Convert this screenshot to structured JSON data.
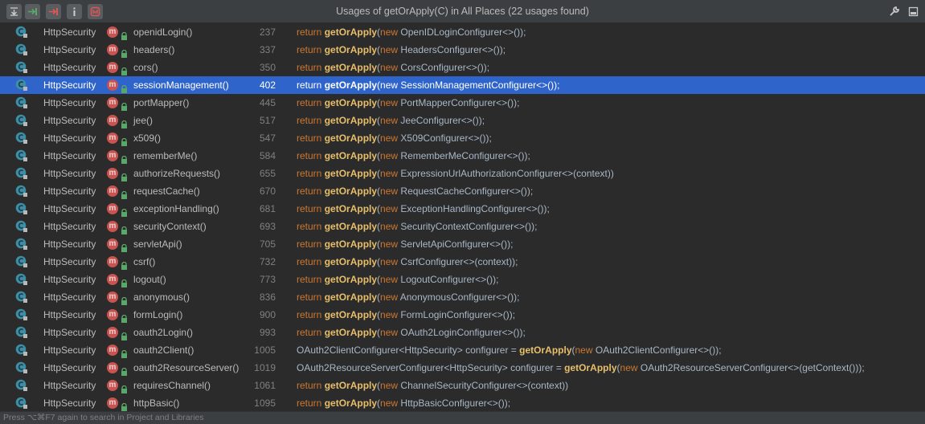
{
  "toolbar": {
    "title": "Usages of getOrApply(C) in All Places (22 usages found)",
    "buttons": [
      "collapse-all-icon",
      "navigate-next-icon",
      "navigate-previous-icon",
      "info-icon",
      "settings-module-icon"
    ],
    "right_buttons": [
      "wrench-icon",
      "maximize-icon"
    ]
  },
  "rows": [
    {
      "cls": "HttpSecurity",
      "method": "openidLogin()",
      "line": "237",
      "pre": "",
      "kw1": "return",
      "mid": "",
      "fn": "getOrApply",
      "kw2": "new",
      "post": "OpenIDLoginConfigurer<>());"
    },
    {
      "cls": "HttpSecurity",
      "method": "headers()",
      "line": "337",
      "pre": "",
      "kw1": "return",
      "mid": "",
      "fn": "getOrApply",
      "kw2": "new",
      "post": "HeadersConfigurer<>());"
    },
    {
      "cls": "HttpSecurity",
      "method": "cors()",
      "line": "350",
      "pre": "",
      "kw1": "return",
      "mid": "",
      "fn": "getOrApply",
      "kw2": "new",
      "post": "CorsConfigurer<>());"
    },
    {
      "cls": "HttpSecurity",
      "method": "sessionManagement()",
      "line": "402",
      "pre": "",
      "kw1": "return",
      "mid": "",
      "fn": "getOrApply",
      "kw2": "new",
      "post": "SessionManagementConfigurer<>());"
    },
    {
      "cls": "HttpSecurity",
      "method": "portMapper()",
      "line": "445",
      "pre": "",
      "kw1": "return",
      "mid": "",
      "fn": "getOrApply",
      "kw2": "new",
      "post": "PortMapperConfigurer<>());"
    },
    {
      "cls": "HttpSecurity",
      "method": "jee()",
      "line": "517",
      "pre": "",
      "kw1": "return",
      "mid": "",
      "fn": "getOrApply",
      "kw2": "new",
      "post": "JeeConfigurer<>());"
    },
    {
      "cls": "HttpSecurity",
      "method": "x509()",
      "line": "547",
      "pre": "",
      "kw1": "return",
      "mid": "",
      "fn": "getOrApply",
      "kw2": "new",
      "post": "X509Configurer<>());"
    },
    {
      "cls": "HttpSecurity",
      "method": "rememberMe()",
      "line": "584",
      "pre": "",
      "kw1": "return",
      "mid": "",
      "fn": "getOrApply",
      "kw2": "new",
      "post": "RememberMeConfigurer<>());"
    },
    {
      "cls": "HttpSecurity",
      "method": "authorizeRequests()",
      "line": "655",
      "pre": "",
      "kw1": "return",
      "mid": "",
      "fn": "getOrApply",
      "kw2": "new",
      "post": "ExpressionUrlAuthorizationConfigurer<>(context))"
    },
    {
      "cls": "HttpSecurity",
      "method": "requestCache()",
      "line": "670",
      "pre": "",
      "kw1": "return",
      "mid": "",
      "fn": "getOrApply",
      "kw2": "new",
      "post": "RequestCacheConfigurer<>());"
    },
    {
      "cls": "HttpSecurity",
      "method": "exceptionHandling()",
      "line": "681",
      "pre": "",
      "kw1": "return",
      "mid": "",
      "fn": "getOrApply",
      "kw2": "new",
      "post": "ExceptionHandlingConfigurer<>());"
    },
    {
      "cls": "HttpSecurity",
      "method": "securityContext()",
      "line": "693",
      "pre": "",
      "kw1": "return",
      "mid": "",
      "fn": "getOrApply",
      "kw2": "new",
      "post": "SecurityContextConfigurer<>());"
    },
    {
      "cls": "HttpSecurity",
      "method": "servletApi()",
      "line": "705",
      "pre": "",
      "kw1": "return",
      "mid": "",
      "fn": "getOrApply",
      "kw2": "new",
      "post": "ServletApiConfigurer<>());"
    },
    {
      "cls": "HttpSecurity",
      "method": "csrf()",
      "line": "732",
      "pre": "",
      "kw1": "return",
      "mid": "",
      "fn": "getOrApply",
      "kw2": "new",
      "post": "CsrfConfigurer<>(context));"
    },
    {
      "cls": "HttpSecurity",
      "method": "logout()",
      "line": "773",
      "pre": "",
      "kw1": "return",
      "mid": "",
      "fn": "getOrApply",
      "kw2": "new",
      "post": "LogoutConfigurer<>());"
    },
    {
      "cls": "HttpSecurity",
      "method": "anonymous()",
      "line": "836",
      "pre": "",
      "kw1": "return",
      "mid": "",
      "fn": "getOrApply",
      "kw2": "new",
      "post": "AnonymousConfigurer<>());"
    },
    {
      "cls": "HttpSecurity",
      "method": "formLogin()",
      "line": "900",
      "pre": "",
      "kw1": "return",
      "mid": "",
      "fn": "getOrApply",
      "kw2": "new",
      "post": "FormLoginConfigurer<>());"
    },
    {
      "cls": "HttpSecurity",
      "method": "oauth2Login()",
      "line": "993",
      "pre": "",
      "kw1": "return",
      "mid": "",
      "fn": "getOrApply",
      "kw2": "new",
      "post": "OAuth2LoginConfigurer<>());"
    },
    {
      "cls": "HttpSecurity",
      "method": "oauth2Client()",
      "line": "1005",
      "pre": "OAuth2ClientConfigurer<HttpSecurity> configurer = ",
      "kw1": "",
      "mid": "",
      "fn": "getOrApply",
      "kw2": "new",
      "post": "OAuth2ClientConfigurer<>());"
    },
    {
      "cls": "HttpSecurity",
      "method": "oauth2ResourceServer()",
      "line": "1019",
      "pre": "OAuth2ResourceServerConfigurer<HttpSecurity> configurer = ",
      "kw1": "",
      "mid": "",
      "fn": "getOrApply",
      "kw2": "new",
      "post": "OAuth2ResourceServerConfigurer<>(getContext()));"
    },
    {
      "cls": "HttpSecurity",
      "method": "requiresChannel()",
      "line": "1061",
      "pre": "",
      "kw1": "return",
      "mid": "",
      "fn": "getOrApply",
      "kw2": "new",
      "post": "ChannelSecurityConfigurer<>(context))"
    },
    {
      "cls": "HttpSecurity",
      "method": "httpBasic()",
      "line": "1095",
      "pre": "",
      "kw1": "return",
      "mid": "",
      "fn": "getOrApply",
      "kw2": "new",
      "post": "HttpBasicConfigurer<>());"
    }
  ],
  "selected_index": 3,
  "status": "Press ⌥⌘F7 again to search in Project and Libraries",
  "colors": {
    "selection": "#2f65ca",
    "keyword": "#cc7832",
    "match": "#e8bf6a",
    "background": "#2b2b2b"
  }
}
